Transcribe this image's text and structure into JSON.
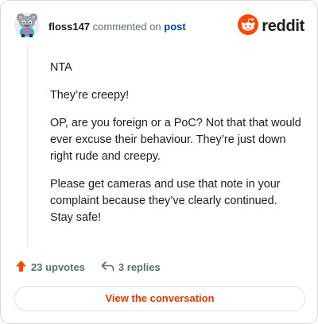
{
  "header": {
    "username": "floss147",
    "action_text": "commented on",
    "post_link": "post",
    "brand": "reddit",
    "avatar_icon": "snoo-avatar-icon",
    "brand_icon": "reddit-logo-icon"
  },
  "comment": {
    "paragraphs": [
      "NTA",
      "They’re creepy!",
      "OP, are you foreign or a PoC? Not that that would ever excuse their behaviour. They’re just down right rude and creepy.",
      "Please get cameras and use that note in your complaint because they’ve clearly continued. Stay safe!"
    ]
  },
  "actions": {
    "upvotes": "23 upvotes",
    "replies": "3 replies",
    "upvote_icon": "upvote-arrow-icon",
    "reply_icon": "reply-arrow-icon"
  },
  "footer": {
    "view_button": "View the conversation"
  },
  "colors": {
    "accent": "#d93a00",
    "brand_orange": "#ff4500",
    "link_blue": "#0045ac",
    "muted": "#576f76"
  }
}
